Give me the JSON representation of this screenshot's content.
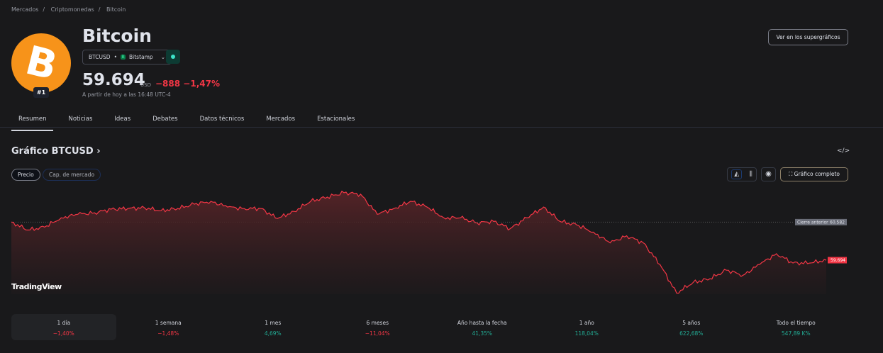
{
  "breadcrumb": [
    "Mercados",
    "Criptomonedas",
    "Bitcoin"
  ],
  "asset": {
    "name": "Bitcoin",
    "rank": "#1",
    "logo_glyph": "B",
    "symbol": "BTCUSD",
    "exchange": "Bitstamp",
    "exchange_glyph": "B",
    "price": "59.694",
    "currency": "USD",
    "change": "−888",
    "change_pct": "−1,47%",
    "as_of": "A partir de hoy a las 16:48 UTC-4"
  },
  "buttons": {
    "supercharts": "Ver en los supergráficos",
    "full_chart": "Gráfico completo",
    "embed": "</>"
  },
  "tabs": [
    "Resumen",
    "Noticias",
    "Ideas",
    "Debates",
    "Datos técnicos",
    "Mercados",
    "Estacionales"
  ],
  "chart_section": {
    "title": "Gráfico BTCUSD",
    "chevron": "›",
    "pills": [
      "Precio",
      "Cap. de mercado"
    ],
    "watermark": "TradingView"
  },
  "chart_data": {
    "type": "area",
    "title": "Gráfico BTCUSD",
    "prev_close_label": "Cierre anterior",
    "prev_close": "60.582",
    "last_label": "59.694",
    "last": 59.694,
    "ylim": [
      58.9,
      61.3
    ],
    "values": [
      60.582,
      60.398,
      60.465,
      60.683,
      60.766,
      60.8,
      60.884,
      60.9,
      60.917,
      60.85,
      60.9,
      61.001,
      61.068,
      60.934,
      60.9,
      60.9,
      60.666,
      60.833,
      61.068,
      61.168,
      61.269,
      61.235,
      60.766,
      60.9,
      61.068,
      60.934,
      60.683,
      60.683,
      60.565,
      60.599,
      60.431,
      60.683,
      60.934,
      60.599,
      60.515,
      60.348,
      60.096,
      60.264,
      60.096,
      59.594,
      58.924,
      59.175,
      59.259,
      59.46,
      59.343,
      59.594,
      59.845,
      59.627,
      59.627,
      59.694
    ],
    "colors": {
      "line": "#f23645",
      "fill": "#5a2428"
    }
  },
  "performance": [
    {
      "label": "1 día",
      "value": "−1,40%",
      "dir": "neg"
    },
    {
      "label": "1 semana",
      "value": "−1,48%",
      "dir": "neg"
    },
    {
      "label": "1 mes",
      "value": "4,69%",
      "dir": "pos"
    },
    {
      "label": "6 meses",
      "value": "−11,04%",
      "dir": "neg"
    },
    {
      "label": "Año hasta la fecha",
      "value": "41,35%",
      "dir": "pos"
    },
    {
      "label": "1 año",
      "value": "118,04%",
      "dir": "pos"
    },
    {
      "label": "5 años",
      "value": "622,68%",
      "dir": "pos"
    },
    {
      "label": "Todo el tiempo",
      "value": "547,89 K%",
      "dir": "pos"
    }
  ]
}
